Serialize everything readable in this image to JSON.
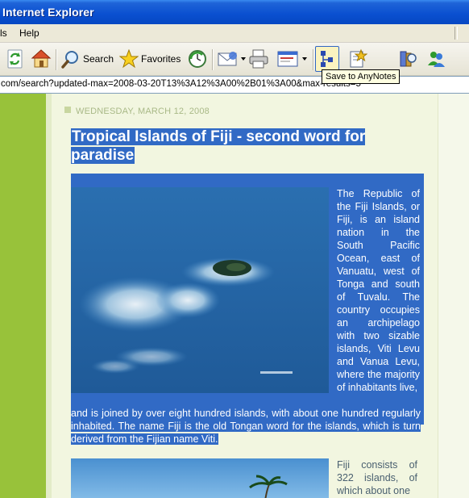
{
  "window": {
    "title": "Internet Explorer"
  },
  "menu": {
    "items": [
      "ls",
      "Help"
    ]
  },
  "toolbar": {
    "search_label": "Search",
    "favorites_label": "Favorites",
    "tooltip": "Save to AnyNotes"
  },
  "address": {
    "url": "com/search?updated-max=2008-03-20T13%3A12%3A00%2B01%3A00&max-results=5"
  },
  "post": {
    "date": "WEDNESDAY, MARCH 12, 2008",
    "title": "Tropical Islands of Fiji - second word for paradise",
    "paragraph1_side": "The Republic of the Fiji Islands, or Fiji, is an island nation in the South Pacific Ocean, east of Vanuatu, west of Tonga and south of Tuvalu. The country occupies an archipelago with two sizable islands, Viti Levu and Vanua Levu, where the majority of inhabitants live,",
    "paragraph1_full": "and is joined by over eight hundred islands, with about one hundred regularly inhabited. The name Fiji is the old Tongan word for the islands, which is turn derived from the Fijian name Viti.",
    "paragraph2_side": "Fiji consists of 322 islands, of which about one"
  },
  "colors": {
    "selection": "#316ac5",
    "sidebar": "#98c23a",
    "page_bg": "#f2f6e0"
  }
}
